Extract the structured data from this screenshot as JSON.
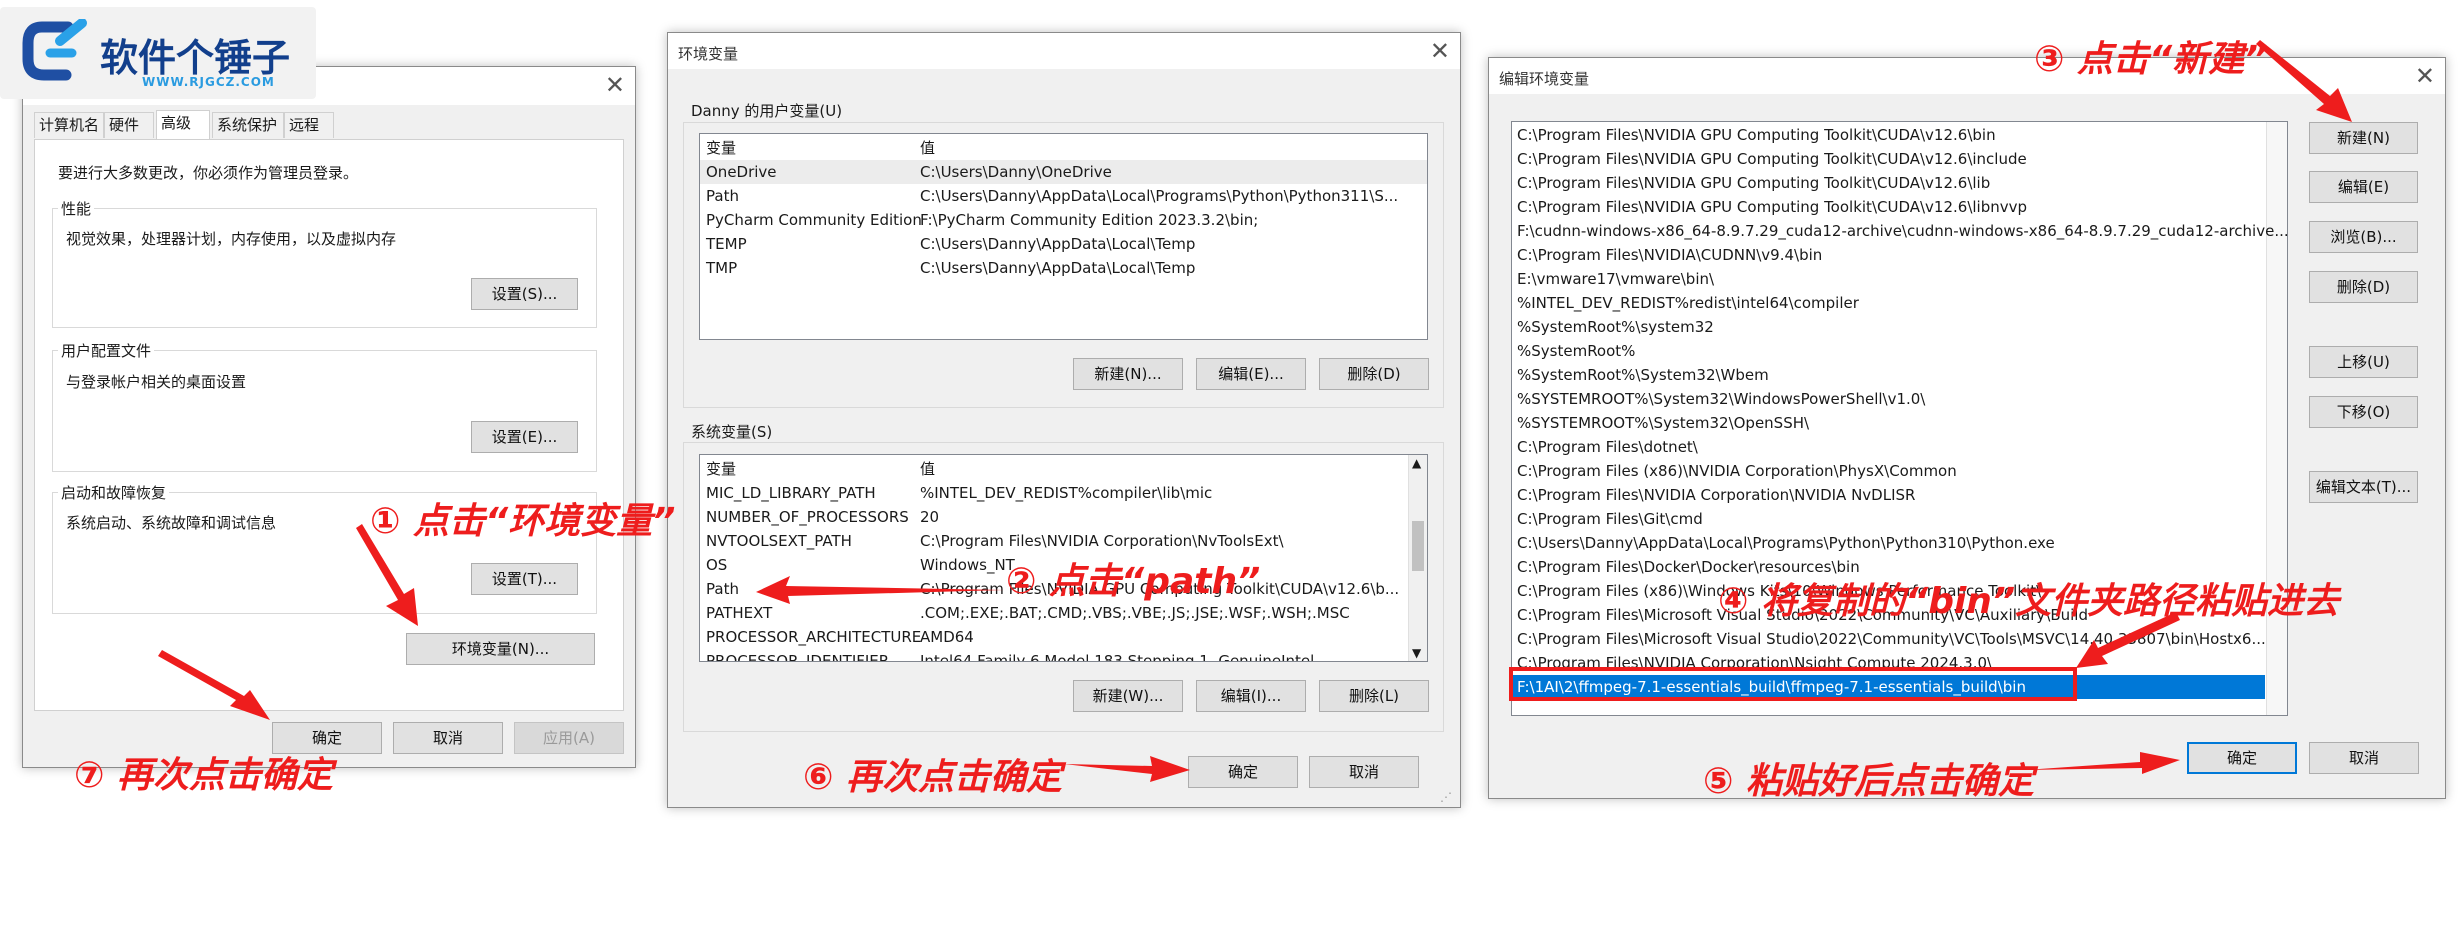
{
  "logo": {
    "brand": "软件个锤子",
    "url": "WWW.RJGCZ.COM"
  },
  "sysprops": {
    "tabs": [
      "计算机名",
      "硬件",
      "高级",
      "系统保护",
      "远程"
    ],
    "admin_note": "要进行大多数更改，你必须作为管理员登录。",
    "perf": {
      "label": "性能",
      "desc": "视觉效果，处理器计划，内存使用，以及虚拟内存",
      "button": "设置(S)..."
    },
    "profile": {
      "label": "用户配置文件",
      "desc": "与登录帐户相关的桌面设置",
      "button": "设置(E)..."
    },
    "startup": {
      "label": "启动和故障恢复",
      "desc": "系统启动、系统故障和调试信息",
      "button": "设置(T)..."
    },
    "env_button": "环境变量(N)...",
    "ok": "确定",
    "cancel": "取消",
    "apply": "应用(A)"
  },
  "envvars": {
    "title": "环境变量",
    "user_group": "Danny 的用户变量(U)",
    "col_var": "变量",
    "col_val": "值",
    "user_rows": [
      {
        "name": "OneDrive",
        "value": "C:\\Users\\Danny\\OneDrive"
      },
      {
        "name": "Path",
        "value": "C:\\Users\\Danny\\AppData\\Local\\Programs\\Python\\Python311\\S..."
      },
      {
        "name": "PyCharm Community Edition",
        "value": "F:\\PyCharm Community Edition 2023.3.2\\bin;"
      },
      {
        "name": "TEMP",
        "value": "C:\\Users\\Danny\\AppData\\Local\\Temp"
      },
      {
        "name": "TMP",
        "value": "C:\\Users\\Danny\\AppData\\Local\\Temp"
      }
    ],
    "user_buttons": [
      "新建(N)...",
      "编辑(E)...",
      "删除(D)"
    ],
    "sys_group": "系统变量(S)",
    "sys_rows": [
      {
        "name": "MIC_LD_LIBRARY_PATH",
        "value": "%INTEL_DEV_REDIST%compiler\\lib\\mic"
      },
      {
        "name": "NUMBER_OF_PROCESSORS",
        "value": "20"
      },
      {
        "name": "NVTOOLSEXT_PATH",
        "value": "C:\\Program Files\\NVIDIA Corporation\\NvToolsExt\\"
      },
      {
        "name": "OS",
        "value": "Windows_NT"
      },
      {
        "name": "Path",
        "value": "C:\\Program Files\\NVIDIA GPU Computing Toolkit\\CUDA\\v12.6\\b..."
      },
      {
        "name": "PATHEXT",
        "value": ".COM;.EXE;.BAT;.CMD;.VBS;.VBE;.JS;.JSE;.WSF;.WSH;.MSC"
      },
      {
        "name": "PROCESSOR_ARCHITECTURE",
        "value": "AMD64"
      },
      {
        "name": "PROCESSOR_IDENTIFIER",
        "value": "Intel64 Family 6 Model 183 Stepping 1, GenuineIntel"
      }
    ],
    "sys_buttons": [
      "新建(W)...",
      "编辑(I)...",
      "删除(L)"
    ],
    "ok": "确定",
    "cancel": "取消"
  },
  "editenv": {
    "title": "编辑环境变量",
    "paths": [
      "C:\\Program Files\\NVIDIA GPU Computing Toolkit\\CUDA\\v12.6\\bin",
      "C:\\Program Files\\NVIDIA GPU Computing Toolkit\\CUDA\\v12.6\\include",
      "C:\\Program Files\\NVIDIA GPU Computing Toolkit\\CUDA\\v12.6\\lib",
      "C:\\Program Files\\NVIDIA GPU Computing Toolkit\\CUDA\\v12.6\\libnvvp",
      "F:\\cudnn-windows-x86_64-8.9.7.29_cuda12-archive\\cudnn-windows-x86_64-8.9.7.29_cuda12-archive...",
      "C:\\Program Files\\NVIDIA\\CUDNN\\v9.4\\bin",
      "E:\\vmware17\\vmware\\bin\\",
      "%INTEL_DEV_REDIST%redist\\intel64\\compiler",
      "%SystemRoot%\\system32",
      "%SystemRoot%",
      "%SystemRoot%\\System32\\Wbem",
      "%SYSTEMROOT%\\System32\\WindowsPowerShell\\v1.0\\",
      "%SYSTEMROOT%\\System32\\OpenSSH\\",
      "C:\\Program Files\\dotnet\\",
      "C:\\Program Files (x86)\\NVIDIA Corporation\\PhysX\\Common",
      "C:\\Program Files\\NVIDIA Corporation\\NVIDIA NvDLISR",
      "C:\\Program Files\\Git\\cmd",
      "C:\\Users\\Danny\\AppData\\Local\\Programs\\Python\\Python310\\Python.exe",
      "C:\\Program Files\\Docker\\Docker\\resources\\bin",
      "C:\\Program Files (x86)\\Windows Kits\\10\\Windows Performance Toolkit\\",
      "C:\\Program Files\\Microsoft Visual Studio\\2022\\Community\\VC\\Auxiliary\\Build",
      "C:\\Program Files\\Microsoft Visual Studio\\2022\\Community\\VC\\Tools\\MSVC\\14.40.33807\\bin\\Hostx6...",
      "C:\\Program Files\\NVIDIA Corporation\\Nsight Compute 2024.3.0\\",
      "F:\\1AI\\2\\ffmpeg-7.1-essentials_build\\ffmpeg-7.1-essentials_build\\bin"
    ],
    "side_buttons": [
      "新建(N)",
      "编辑(E)",
      "浏览(B)...",
      "删除(D)",
      "上移(U)",
      "下移(O)",
      "编辑文本(T)..."
    ],
    "ok": "确定",
    "cancel": "取消"
  },
  "annotations": {
    "a1": "① 点击“环境变量”",
    "a2": "② 点击“path”",
    "a3": "③ 点击“新建”",
    "a4": "④ 将复制的“bin”文件夹路径粘贴进去",
    "a5": "⑤ 粘贴好后点击确定",
    "a6": "⑥ 再次点击确定",
    "a7": "⑦ 再次点击确定"
  }
}
